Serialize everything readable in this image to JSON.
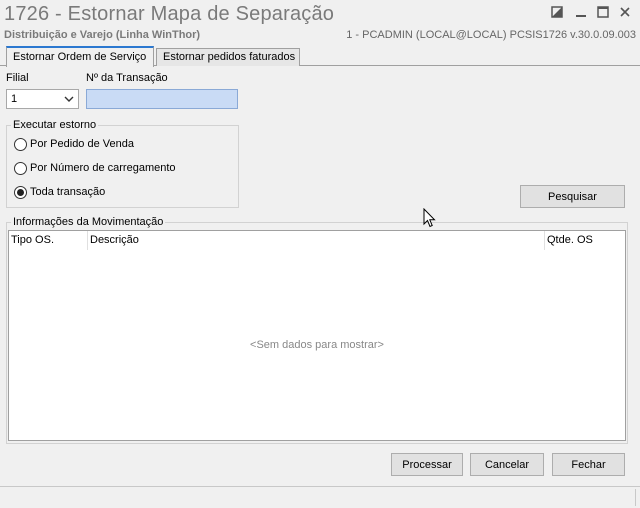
{
  "window": {
    "title": "1726 - Estornar Mapa de Separação",
    "subtitle": "Distribuição e Varejo (Linha WinThor)",
    "session": "1 - PCADMIN (LOCAL@LOCAL)   PCSIS1726  v.30.0.09.003",
    "controls": [
      "restore-icon",
      "minimize-icon",
      "maximize-icon",
      "close-icon"
    ]
  },
  "tabs": [
    {
      "label": "Estornar Ordem de Serviço",
      "active": true
    },
    {
      "label": "Estornar pedidos faturados",
      "active": false
    }
  ],
  "filters": {
    "filial_label": "Filial",
    "filial_value": "1",
    "transacao_label": "Nº da Transação",
    "transacao_value": ""
  },
  "estorno": {
    "legend": "Executar estorno",
    "options": [
      {
        "label": "Por Pedido de Venda",
        "checked": false
      },
      {
        "label": "Por Número de carregamento",
        "checked": false
      },
      {
        "label": "Toda transação",
        "checked": true
      }
    ]
  },
  "buttons": {
    "pesquisar": "Pesquisar",
    "processar": "Processar",
    "cancelar": "Cancelar",
    "fechar": "Fechar"
  },
  "movimentacao": {
    "legend": "Informações da Movimentação",
    "columns": [
      "Tipo OS.",
      "Descrição",
      "Qtde. OS"
    ],
    "empty_message": "<Sem dados para mostrar>"
  },
  "colors": {
    "accent": "#2b78d0",
    "input_highlight": "#c9dbf5",
    "title_text": "#7a7a7a"
  }
}
